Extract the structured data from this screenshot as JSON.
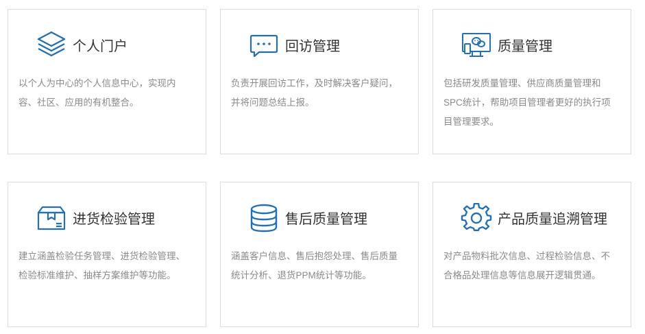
{
  "accent_color": "#1f6fba",
  "cards": [
    {
      "icon": "layers-icon",
      "title": "个人门户",
      "desc": "以个人为中心的个人信息中心，实现内容、社区、应用的有机整合。"
    },
    {
      "icon": "chat-bubble-icon",
      "title": "回访管理",
      "desc": "负责开展回访工作，及时解决客户疑问，并将问题总结上报。"
    },
    {
      "icon": "monitor-chat-icon",
      "title": "质量管理",
      "desc": "包括研发质量管理、供应商质量管理和SPC统计，帮助项目管理者更好的执行项目管理要求。"
    },
    {
      "icon": "package-box-icon",
      "title": "进货检验管理",
      "desc": "建立涵盖检验任务管理、进货检验管理、检验标准维护、抽样方案维护等功能。"
    },
    {
      "icon": "database-icon",
      "title": "售后质量管理",
      "desc": "涵盖客户信息、售后抱怨处理、售后质量统计分析、退货PPM统计等功能。"
    },
    {
      "icon": "gear-icon",
      "title": "产品质量追溯管理",
      "desc": "对产品物料批次信息、过程检验信息、不合格品处理信息等信息展开逻辑贯通。"
    }
  ]
}
